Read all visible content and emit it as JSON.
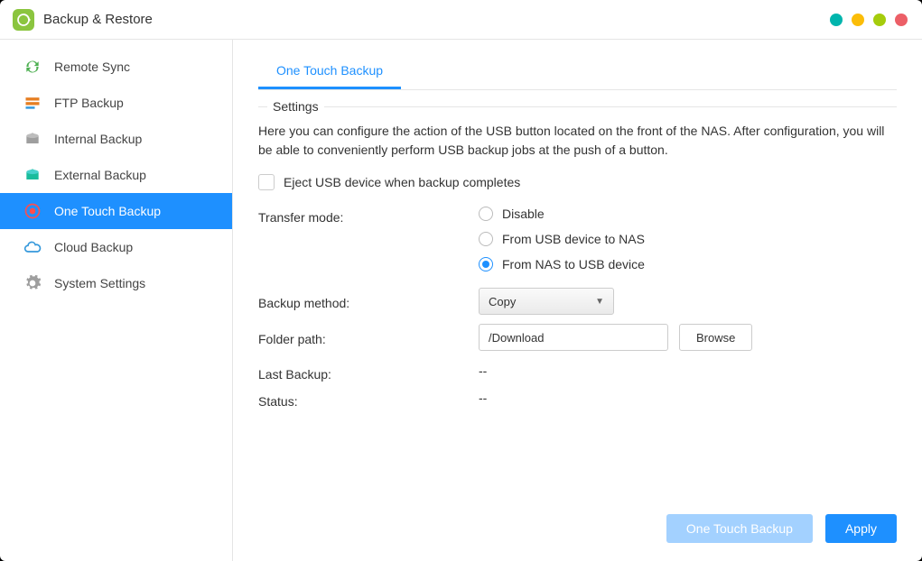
{
  "app_title": "Backup & Restore",
  "sidebar": {
    "items": [
      {
        "label": "Remote Sync"
      },
      {
        "label": "FTP Backup"
      },
      {
        "label": "Internal Backup"
      },
      {
        "label": "External Backup"
      },
      {
        "label": "One Touch Backup"
      },
      {
        "label": "Cloud Backup"
      },
      {
        "label": "System Settings"
      }
    ]
  },
  "tabs": {
    "active": "One Touch Backup"
  },
  "settings": {
    "legend": "Settings",
    "description": "Here you can configure the action of the USB button located on the front of the NAS. After configuration, you will be able to conveniently perform USB backup jobs at the push of a button.",
    "eject_label": "Eject USB device when backup completes",
    "transfer_label": "Transfer mode:",
    "transfer_options": {
      "disable": "Disable",
      "usb_to_nas": "From USB device to NAS",
      "nas_to_usb": "From NAS to USB device"
    },
    "backup_method_label": "Backup method:",
    "backup_method_value": "Copy",
    "folder_path_label": "Folder path:",
    "folder_path_value": "/Download",
    "browse_label": "Browse",
    "last_backup_label": "Last Backup:",
    "last_backup_value": "--",
    "status_label": "Status:",
    "status_value": "--"
  },
  "footer": {
    "one_touch": "One Touch Backup",
    "apply": "Apply"
  }
}
